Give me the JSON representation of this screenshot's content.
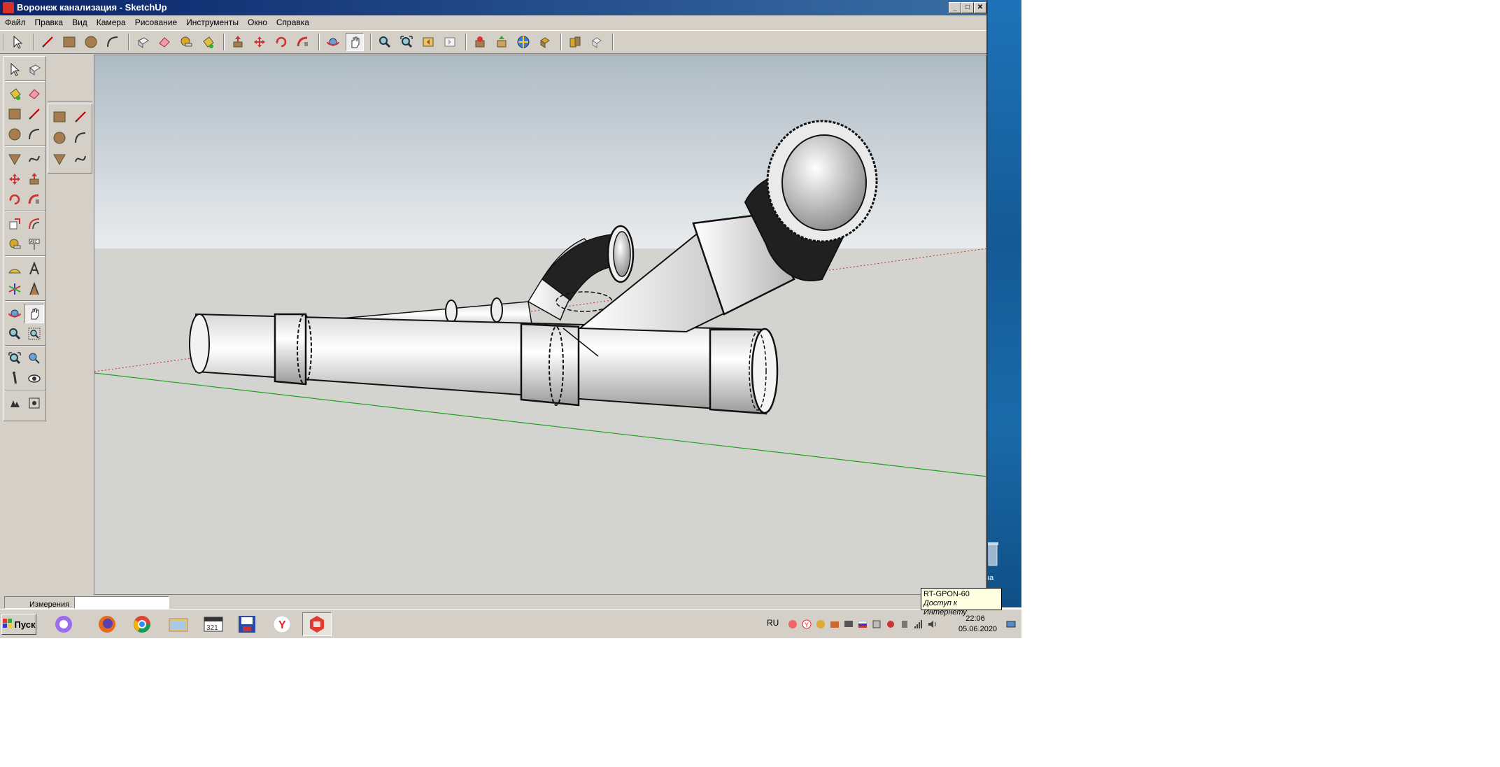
{
  "window": {
    "title": "Воронеж канализация - SketchUp",
    "buttons": [
      "_",
      "□",
      "✕"
    ]
  },
  "menu": [
    "Файл",
    "Правка",
    "Вид",
    "Камера",
    "Рисование",
    "Инструменты",
    "Окно",
    "Справка"
  ],
  "toolbar": {
    "icons": [
      "select-icon",
      "line-icon",
      "rectangle-icon",
      "circle-icon",
      "arc-icon",
      "make-component-icon",
      "eraser-icon",
      "tape-measure-icon",
      "paint-bucket-icon",
      "push-pull-icon",
      "move-icon",
      "rotate-icon",
      "follow-me-icon",
      "orbit-icon",
      "pan-icon",
      "zoom-icon",
      "zoom-extents-icon",
      "previous-view-icon",
      "next-view-icon",
      "get-models-icon",
      "share-model-icon",
      "3d-warehouse-icon",
      "components-icon",
      "materials-icon",
      "styles-icon"
    ]
  },
  "left_tools": {
    "icons": [
      "select-icon",
      "make-component-icon",
      "paint-bucket-icon",
      "eraser-icon",
      "rectangle-icon",
      "line-icon",
      "circle-icon",
      "arc-icon",
      "polygon-icon",
      "freehand-icon",
      "move-icon",
      "push-pull-icon",
      "rotate-icon",
      "follow-me-icon",
      "scale-icon",
      "offset-icon",
      "tape-measure-icon",
      "dimension-icon",
      "protractor-icon",
      "text-icon",
      "axes-icon",
      "3d-text-icon",
      "orbit-icon",
      "pan-icon",
      "zoom-icon",
      "zoom-window-icon",
      "zoom-extents-icon",
      "previous-icon",
      "walk-icon",
      "look-around-icon",
      "position-camera-icon",
      "section-plane-icon"
    ]
  },
  "status": {
    "measure_label": "Измерения",
    "measure_value": ""
  },
  "taskbar": {
    "start_label": "Пуск",
    "apps": [
      "alice-icon",
      "firefox-icon",
      "chrome-icon",
      "explorer-icon",
      "media-player-icon",
      "save-icon",
      "yandex-browser-icon",
      "sketchup-icon"
    ],
    "lang": "RU",
    "time": "22:06",
    "date": "05.06.2020"
  },
  "tooltip": {
    "line1": "RT-GPON-60",
    "line2": "Доступ к Интернету"
  },
  "desktop": {
    "recycle_label": "на"
  },
  "colors": {
    "title_bar": "#0a246a",
    "sky": "#c9d2d8",
    "ground": "#d3d3d0",
    "green_axis": "#22a022",
    "red_axis": "#c03030"
  }
}
